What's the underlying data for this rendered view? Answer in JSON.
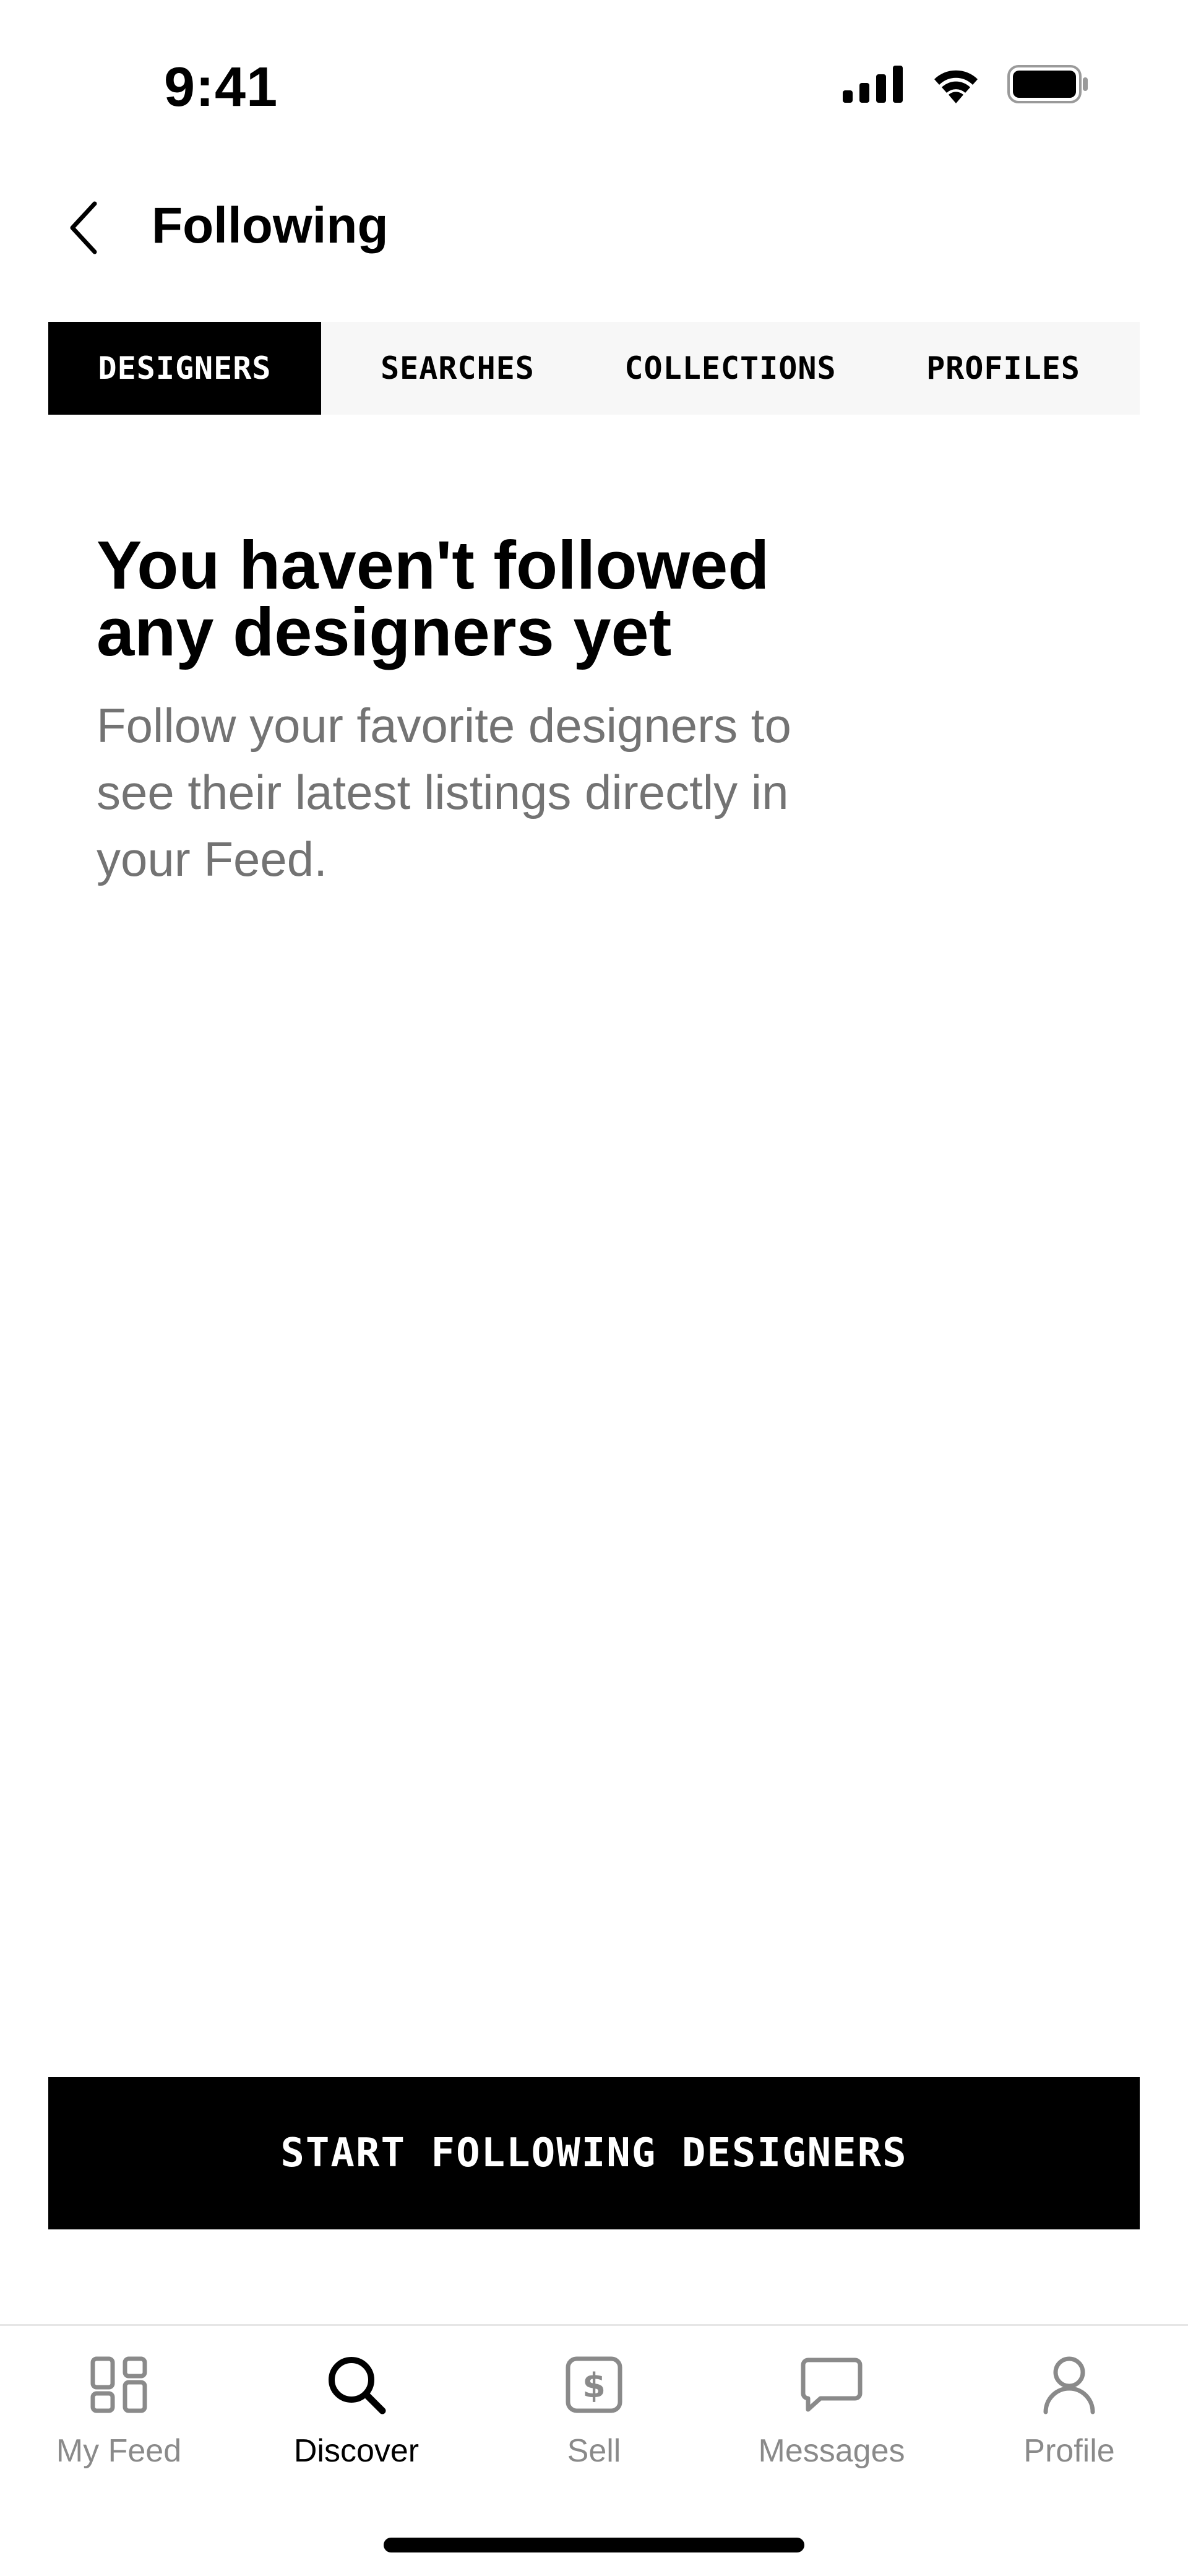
{
  "status_bar": {
    "time": "9:41"
  },
  "header": {
    "title": "Following",
    "back_icon": "chevron-left-icon"
  },
  "tabs": [
    {
      "label": "DESIGNERS",
      "active": true
    },
    {
      "label": "SEARCHES",
      "active": false
    },
    {
      "label": "COLLECTIONS",
      "active": false
    },
    {
      "label": "PROFILES",
      "active": false
    }
  ],
  "empty_state": {
    "title": "You haven't followed any designers yet",
    "description": "Follow your favorite designers to see their latest listings directly in your Feed."
  },
  "cta": {
    "label": "START FOLLOWING DESIGNERS"
  },
  "bottom_nav": {
    "items": [
      {
        "label": "My Feed",
        "icon": "grid-icon",
        "active": false
      },
      {
        "label": "Discover",
        "icon": "search-icon",
        "active": true
      },
      {
        "label": "Sell",
        "icon": "dollar-tag-icon",
        "active": false
      },
      {
        "label": "Messages",
        "icon": "chat-bubble-icon",
        "active": false
      },
      {
        "label": "Profile",
        "icon": "person-icon",
        "active": false
      }
    ]
  },
  "colors": {
    "accent": "#000000",
    "tab_bg": "#f7f7f7",
    "muted_text": "#737373",
    "nav_inactive": "#8a8a8a"
  }
}
